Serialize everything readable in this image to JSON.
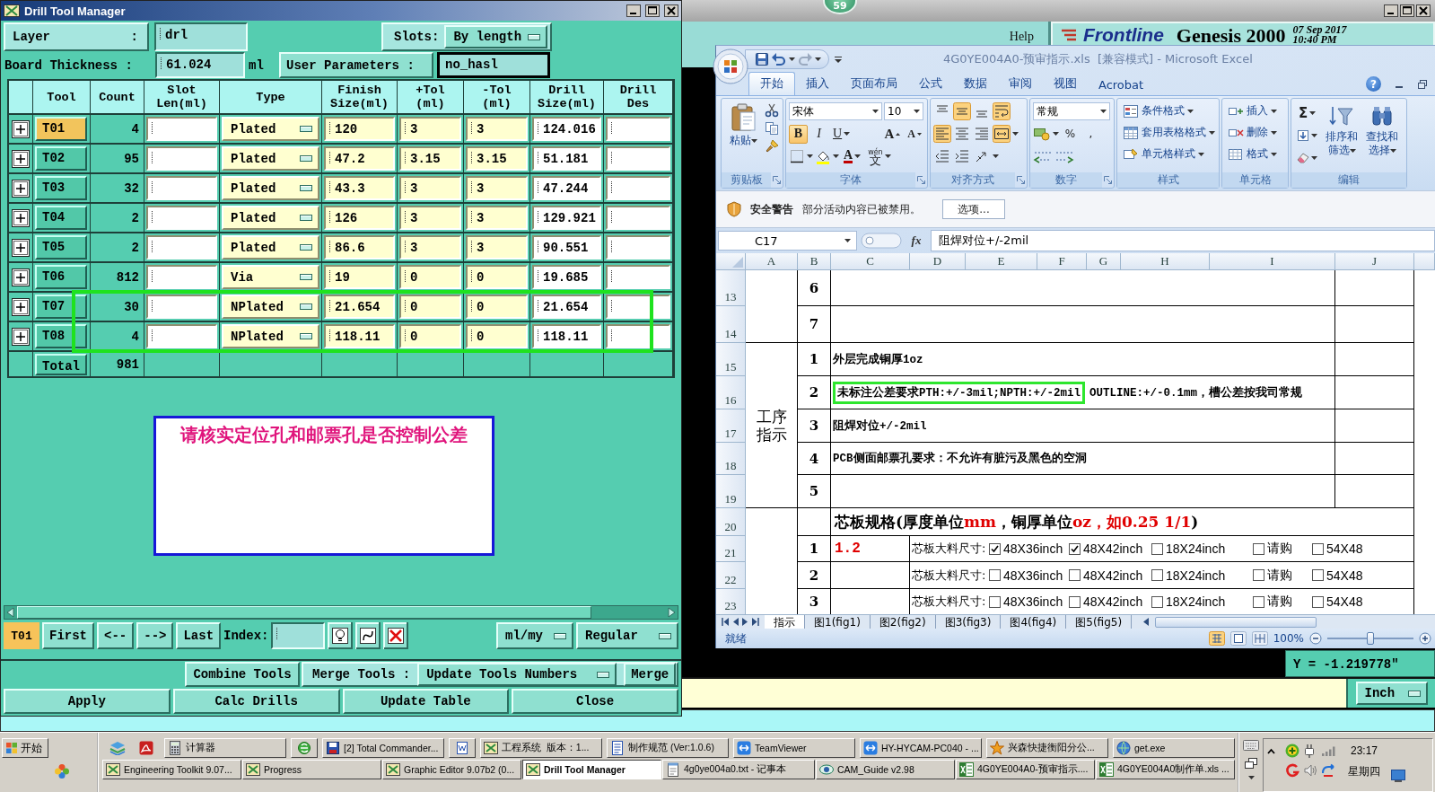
{
  "background_window": {
    "badge": "59",
    "help": "Help",
    "logo": "Frontline",
    "product": "Genesis 2000",
    "date": "07 Sep 2017",
    "time": "10:40 PM",
    "coordinate": "Y = -1.219778\"",
    "units": "Inch"
  },
  "drill_tool_manager": {
    "title": "Drill Tool Manager",
    "layer": {
      "label": "Layer",
      "separator": ":",
      "value": "drl"
    },
    "slots": {
      "label": "Slots:",
      "value": "By length"
    },
    "board_thickness": {
      "label": "Board Thickness :",
      "value": "61.024",
      "unit": "ml"
    },
    "user_parameters": {
      "label": "User Parameters :",
      "value": "no_hasl"
    },
    "table": {
      "columns": [
        "Tool",
        "Count",
        "Slot\nLen(ml)",
        "Type",
        "Finish\nSize(ml)",
        "+Tol\n(ml)",
        "-Tol\n(ml)",
        "Drill\nSize(ml)",
        "Drill\nDes"
      ],
      "rows": [
        {
          "tool": "T01",
          "selected": true,
          "highlighted": false,
          "count": "4",
          "type": "Plated",
          "finish_size": "120",
          "plus_tol": "3",
          "minus_tol": "3",
          "drill_size": "124.016"
        },
        {
          "tool": "T02",
          "selected": false,
          "highlighted": false,
          "count": "95",
          "type": "Plated",
          "finish_size": "47.2",
          "plus_tol": "3.15",
          "minus_tol": "3.15",
          "drill_size": "51.181"
        },
        {
          "tool": "T03",
          "selected": false,
          "highlighted": false,
          "count": "32",
          "type": "Plated",
          "finish_size": "43.3",
          "plus_tol": "3",
          "minus_tol": "3",
          "drill_size": "47.244"
        },
        {
          "tool": "T04",
          "selected": false,
          "highlighted": false,
          "count": "2",
          "type": "Plated",
          "finish_size": "126",
          "plus_tol": "3",
          "minus_tol": "3",
          "drill_size": "129.921"
        },
        {
          "tool": "T05",
          "selected": false,
          "highlighted": false,
          "count": "2",
          "type": "Plated",
          "finish_size": "86.6",
          "plus_tol": "3",
          "minus_tol": "3",
          "drill_size": "90.551"
        },
        {
          "tool": "T06",
          "selected": false,
          "highlighted": false,
          "count": "812",
          "type": "Via",
          "finish_size": "19",
          "plus_tol": "0",
          "minus_tol": "0",
          "drill_size": "19.685"
        },
        {
          "tool": "T07",
          "selected": false,
          "highlighted": true,
          "count": "30",
          "type": "NPlated",
          "finish_size": "21.654",
          "plus_tol": "0",
          "minus_tol": "0",
          "drill_size": "21.654"
        },
        {
          "tool": "T08",
          "selected": false,
          "highlighted": true,
          "count": "4",
          "type": "NPlated",
          "finish_size": "118.11",
          "plus_tol": "0",
          "minus_tol": "0",
          "drill_size": "118.11"
        }
      ],
      "total": {
        "label": "Total",
        "count": "981"
      }
    },
    "message": "请核实定位孔和邮票孔是否控制公差",
    "navigation": {
      "current_tool": "T01",
      "buttons": [
        "First",
        "<--",
        "-->",
        "Last"
      ],
      "index_label": "Index:",
      "units": "ml/my",
      "mode": "Regular"
    },
    "merge_bar": {
      "combine": "Combine Tools",
      "label": "Merge Tools :",
      "mode": "Update Tools Numbers",
      "merge": "Merge"
    },
    "buttons": [
      "Apply",
      "Calc Drills",
      "Update Table",
      "Close"
    ]
  },
  "excel": {
    "title": "4G0YE004A0-预审指示.xls  [兼容模式] - Microsoft Excel",
    "help_glyph": "?",
    "tabs": [
      {
        "label": "开始",
        "selected": true
      },
      {
        "label": "插入",
        "selected": false
      },
      {
        "label": "页面布局",
        "selected": false
      },
      {
        "label": "公式",
        "selected": false
      },
      {
        "label": "数据",
        "selected": false
      },
      {
        "label": "审阅",
        "selected": false
      },
      {
        "label": "视图",
        "selected": false
      },
      {
        "label": "Acrobat",
        "selected": false
      }
    ],
    "clipboard": {
      "label": "剪贴板",
      "paste": "粘贴"
    },
    "font": {
      "label": "字体",
      "name": "宋体",
      "size": "10",
      "styles": [
        {
          "kind": "bold",
          "glyph": "B",
          "selected": true
        },
        {
          "kind": "italic",
          "glyph": "I",
          "selected": false
        },
        {
          "kind": "underline",
          "glyph": "U",
          "selected": false
        }
      ],
      "grow": "A",
      "shrink": "A",
      "color_glyph": "A",
      "phonetic_top": "wén",
      "phonetic": "文"
    },
    "alignment": {
      "label": "对齐方式",
      "rows": [
        [
          {
            "kind": "top",
            "selected": false
          },
          {
            "kind": "middle",
            "selected": true
          },
          {
            "kind": "bottom",
            "selected": false
          },
          {
            "kind": "wrap",
            "selected": true
          }
        ],
        [
          {
            "kind": "left",
            "selected": true
          },
          {
            "kind": "center",
            "selected": false
          },
          {
            "kind": "right",
            "selected": false
          },
          {
            "kind": "merge",
            "selected": true
          }
        ],
        [
          {
            "kind": "outdent",
            "selected": false
          },
          {
            "kind": "indent",
            "selected": false
          },
          {
            "kind": "orientation",
            "selected": false
          }
        ]
      ]
    },
    "number": {
      "label": "数字",
      "format": "常规",
      "percent": "%",
      "comma": ","
    },
    "styles": {
      "label": "样式",
      "items": [
        {
          "kind": "conditional",
          "label": "条件格式"
        },
        {
          "kind": "table",
          "label": "套用表格格式"
        },
        {
          "kind": "cell",
          "label": "单元格样式"
        }
      ]
    },
    "cells": {
      "label": "单元格",
      "items": [
        {
          "kind": "insert",
          "label": "插入"
        },
        {
          "kind": "delete",
          "label": "删除"
        },
        {
          "kind": "format",
          "label": "格式"
        }
      ]
    },
    "editing": {
      "label": "编辑",
      "sum": "Σ",
      "sort": "排序和筛选",
      "find": "查找和选择"
    },
    "security": {
      "title": "安全警告",
      "message": "部分活动内容已被禁用。",
      "button": "选项..."
    },
    "formula_bar": {
      "cell": "C17",
      "function_glyph": "fx",
      "formula": "阻焊对位+/-2mil"
    },
    "sheet": {
      "columns": [
        "A",
        "B",
        "C",
        "D",
        "E",
        "F",
        "G",
        "H",
        "I",
        "J"
      ],
      "groups": [
        {
          "rows": [
            {
              "number": "13",
              "kind": "item",
              "index": "6"
            },
            {
              "number": "14",
              "kind": "item",
              "index": "7"
            }
          ]
        },
        {
          "label": "工序指示",
          "rows": [
            {
              "number": "15",
              "kind": "item",
              "index": "1",
              "segments": [
                {
                  "text": "外层完成铜厚1oz",
                  "highlighted": false
                }
              ]
            },
            {
              "number": "16",
              "kind": "item",
              "index": "2",
              "segments": [
                {
                  "text": "未标注公差要求PTH:+/-3mil;NPTH:+/-2mil",
                  "highlighted": true
                },
                {
                  "text": "OUTLINE:+/-0.1mm，槽公差按我司常规",
                  "highlighted": false
                }
              ]
            },
            {
              "number": "17",
              "kind": "item",
              "index": "3",
              "segments": [
                {
                  "text": "阻焊对位+/-2mil",
                  "highlighted": false
                }
              ]
            },
            {
              "number": "18",
              "kind": "item",
              "index": "4",
              "segments": [
                {
                  "text": "PCB侧面邮票孔要求：不允许有脏污及黑色的空洞",
                  "highlighted": false
                }
              ]
            },
            {
              "number": "19",
              "kind": "item",
              "index": "5"
            }
          ]
        },
        {
          "rows": [
            {
              "number": "20",
              "kind": "heading",
              "segments": [
                {
                  "text": "芯板规格(厚度单位",
                  "color": "#000000"
                },
                {
                  "text": "mm",
                  "color": "#e00000"
                },
                {
                  "text": "，铜厚单位",
                  "color": "#000000"
                },
                {
                  "text": "oz，如0.25 1/1",
                  "color": "#e00000"
                },
                {
                  "text": ")",
                  "color": "#000000"
                }
              ]
            },
            {
              "number": "21",
              "kind": "material",
              "index": "1",
              "thickness": "1.2",
              "label": "芯板大料尺寸:",
              "options": [
                {
                  "label": "48X36inch",
                  "checked": true
                },
                {
                  "label": "48X42inch",
                  "checked": true
                },
                {
                  "label": "18X24inch",
                  "checked": false
                },
                {
                  "label": "请购",
                  "checked": false
                },
                {
                  "label": "54X48",
                  "checked": false
                }
              ]
            },
            {
              "number": "22",
              "kind": "material",
              "index": "2",
              "label": "芯板大料尺寸:",
              "options": [
                {
                  "label": "48X36inch",
                  "checked": false
                },
                {
                  "label": "48X42inch",
                  "checked": false
                },
                {
                  "label": "18X24inch",
                  "checked": false
                },
                {
                  "label": "请购",
                  "checked": false
                },
                {
                  "label": "54X48",
                  "checked": false
                }
              ]
            },
            {
              "number": "23",
              "kind": "material",
              "index": "3",
              "label": "芯板大料尺寸:",
              "options": [
                {
                  "label": "48X36inch",
                  "checked": false
                },
                {
                  "label": "48X42inch",
                  "checked": false
                },
                {
                  "label": "18X24inch",
                  "checked": false
                },
                {
                  "label": "请购",
                  "checked": false
                },
                {
                  "label": "54X48",
                  "checked": false
                }
              ]
            }
          ]
        }
      ]
    },
    "sheet_tabs": [
      {
        "label": "指示",
        "selected": true
      },
      {
        "label": "图1(fig1)",
        "selected": false
      },
      {
        "label": "图2(fig2)",
        "selected": false
      },
      {
        "label": "图3(fig3)",
        "selected": false
      },
      {
        "label": "图4(fig4)",
        "selected": false
      },
      {
        "label": "图5(fig5)",
        "selected": false
      }
    ],
    "status": {
      "text": "就绪",
      "views": [
        {
          "kind": "normal",
          "selected": true
        },
        {
          "kind": "layout",
          "selected": false
        },
        {
          "kind": "break",
          "selected": false
        }
      ],
      "zoom": {
        "label": "100%",
        "level": 0.5
      }
    }
  },
  "taskbar": {
    "start": "开始",
    "top_row": [
      {
        "kind": "calculator",
        "label": "计算器",
        "selected": false
      },
      {
        "kind": "browser",
        "selected": false
      },
      {
        "kind": "disk",
        "label": "[2] Total Commander...",
        "selected": false
      },
      {
        "kind": "document",
        "selected": false
      },
      {
        "kind": "app",
        "label": "工程系统  版本：1...",
        "selected": false
      },
      {
        "kind": "list",
        "label": "制作规范 (Ver:1.0.6)",
        "selected": false
      },
      {
        "kind": "remote",
        "label": "TeamViewer",
        "selected": false
      },
      {
        "kind": "remote",
        "label": "HY-HYCAM-PC040 - ...",
        "selected": false
      },
      {
        "kind": "star",
        "label": "兴森快捷衡阳分公...",
        "selected": false
      },
      {
        "kind": "globe",
        "label": "get.exe",
        "selected": false
      }
    ],
    "bottom_row": [
      {
        "kind": "app",
        "label": "Engineering Toolkit 9.07...",
        "selected": false
      },
      {
        "kind": "app",
        "label": "Progress",
        "selected": false
      },
      {
        "kind": "app",
        "label": "Graphic Editor 9.07b2 (0...",
        "selected": false
      },
      {
        "kind": "app",
        "label": "Drill Tool Manager",
        "selected": true
      },
      {
        "kind": "notepad",
        "label": "4g0ye004a0.txt - 记事本",
        "selected": false
      },
      {
        "kind": "eye",
        "label": "CAM_Guide v2.98",
        "selected": false
      },
      {
        "kind": "sheet",
        "label": "4G0YE004A0-预审指示....",
        "selected": false
      },
      {
        "kind": "sheet",
        "label": "4G0YE004A0制作单.xls ...",
        "selected": false
      }
    ],
    "clock": {
      "time": "23:17",
      "day": "星期四"
    }
  }
}
